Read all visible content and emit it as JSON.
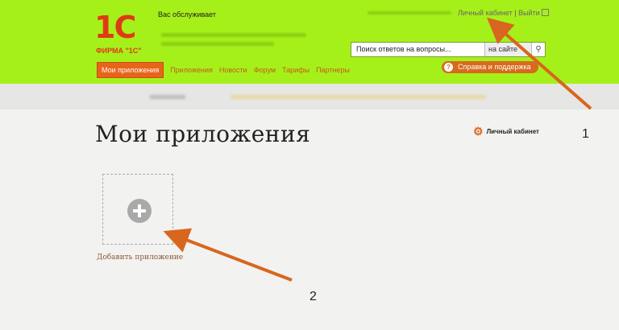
{
  "header": {
    "logo_mark": "1С",
    "logo_text": "ФИРМА \"1С\"",
    "served_by": "Вас обслуживает",
    "personal_account_link": "Личный кабинет",
    "logout_link": "Выйти"
  },
  "search": {
    "placeholder": "Поиск ответов на вопросы...",
    "scope": "на сайте"
  },
  "nav": {
    "items": [
      "Мои приложения",
      "Приложения",
      "Новости",
      "Форум",
      "Тарифы",
      "Партнеры"
    ],
    "active_index": 0
  },
  "help_button": "Справка и поддержка",
  "page_title": "Мои приложения",
  "personal_account_button": "Личный кабинет",
  "add_app_label": "Добавить приложение",
  "annotations": [
    "1",
    "2"
  ],
  "colors": {
    "header_bg": "#a6f01a",
    "accent": "#e8641a",
    "arrow": "#d8661e"
  }
}
